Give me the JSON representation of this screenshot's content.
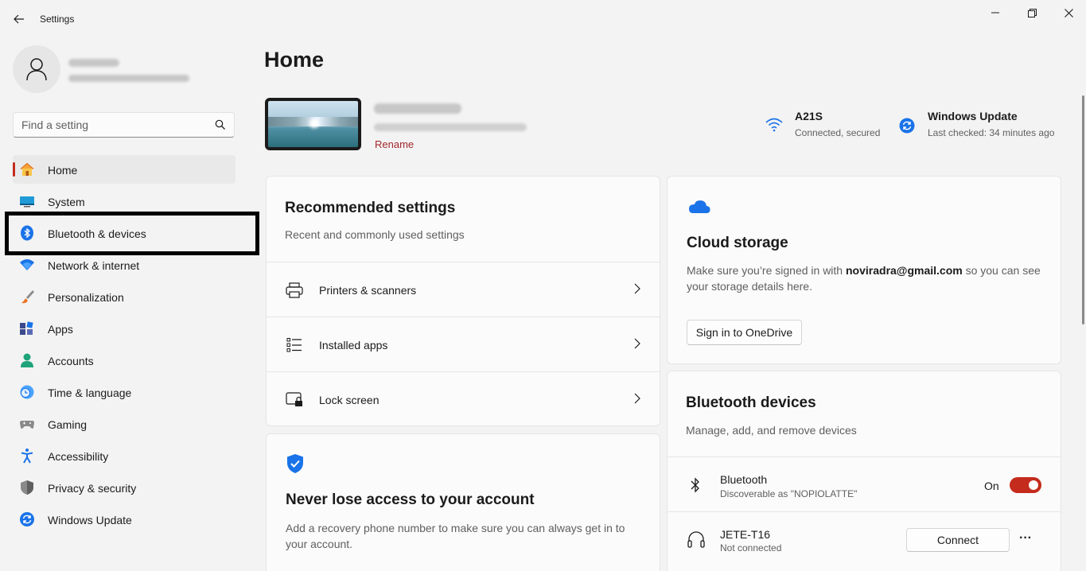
{
  "window": {
    "title": "Settings"
  },
  "sidebar": {
    "search_placeholder": "Find a setting",
    "items": [
      {
        "label": "Home",
        "icon": "home-icon"
      },
      {
        "label": "System",
        "icon": "system-icon"
      },
      {
        "label": "Bluetooth & devices",
        "icon": "bluetooth-icon"
      },
      {
        "label": "Network & internet",
        "icon": "wifi-icon"
      },
      {
        "label": "Personalization",
        "icon": "brush-icon"
      },
      {
        "label": "Apps",
        "icon": "apps-icon"
      },
      {
        "label": "Accounts",
        "icon": "accounts-icon"
      },
      {
        "label": "Time & language",
        "icon": "clock-globe-icon"
      },
      {
        "label": "Gaming",
        "icon": "gamepad-icon"
      },
      {
        "label": "Accessibility",
        "icon": "accessibility-icon"
      },
      {
        "label": "Privacy & security",
        "icon": "shield-icon"
      },
      {
        "label": "Windows Update",
        "icon": "update-icon"
      }
    ],
    "active_index": 0,
    "highlighted_index": 2
  },
  "main": {
    "title": "Home",
    "device": {
      "rename_label": "Rename"
    },
    "network": {
      "name": "A21S",
      "status": "Connected, secured"
    },
    "update": {
      "title": "Windows Update",
      "status": "Last checked: 34 minutes ago"
    },
    "recommended": {
      "title": "Recommended settings",
      "subtitle": "Recent and commonly used settings",
      "rows": [
        {
          "label": "Printers & scanners",
          "icon": "printer-icon"
        },
        {
          "label": "Installed apps",
          "icon": "list-icon"
        },
        {
          "label": "Lock screen",
          "icon": "lock-screen-icon"
        }
      ]
    },
    "account_card": {
      "title": "Never lose access to your account",
      "text": "Add a recovery phone number to make sure you can always get in to your account."
    },
    "cloud": {
      "title": "Cloud storage",
      "text_before": "Make sure you’re signed in with ",
      "email": "noviradra@gmail.com",
      "text_after": " so you can see your storage details here.",
      "button": "Sign in to OneDrive"
    },
    "bluetooth": {
      "title": "Bluetooth devices",
      "subtitle": "Manage, add, and remove devices",
      "bt_label": "Bluetooth",
      "bt_sub": "Discoverable as \"NOPIOLATTE\"",
      "bt_state": "On",
      "device_name": "JETE-T16",
      "device_status": "Not connected",
      "connect_button": "Connect",
      "more_label": "···"
    }
  },
  "colors": {
    "accent": "#c42b1c",
    "link": "#a4262c",
    "background": "#f3f3f3",
    "card": "#fbfbfb"
  }
}
